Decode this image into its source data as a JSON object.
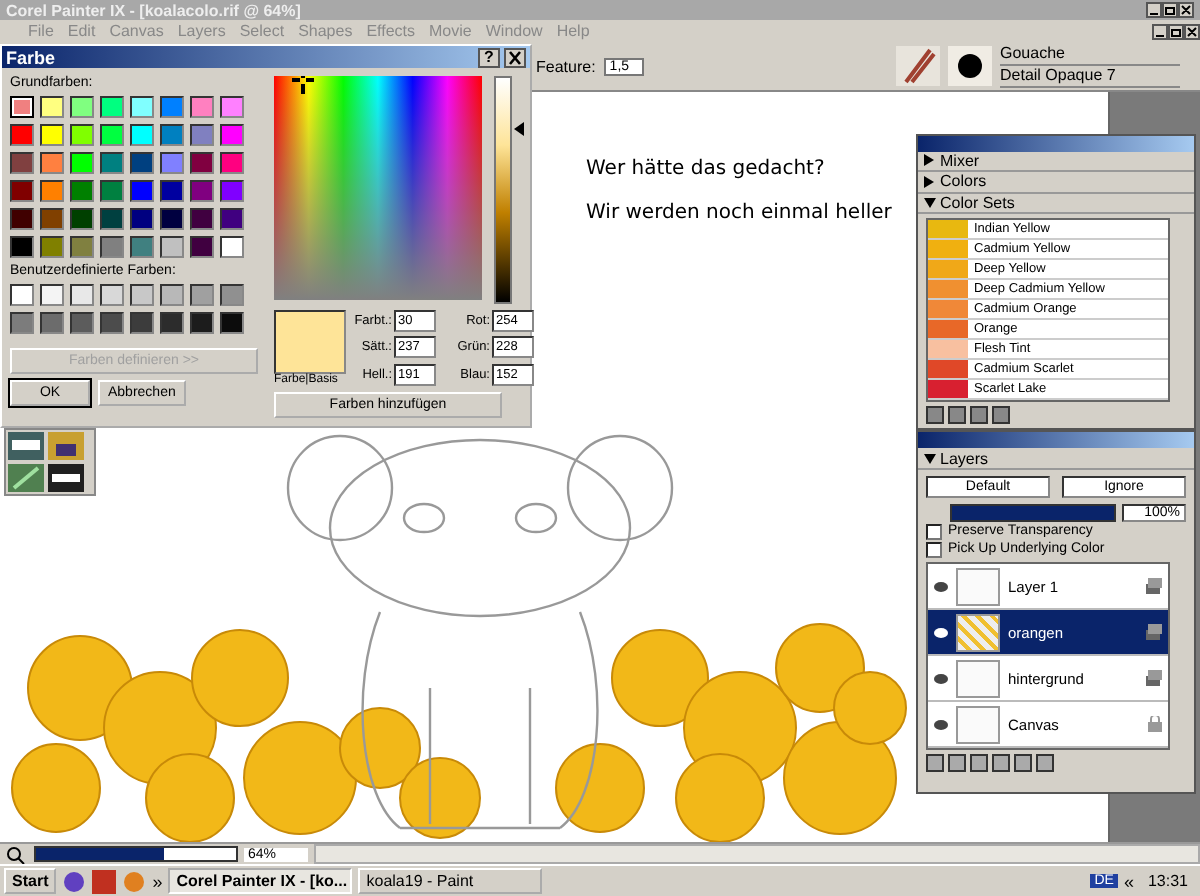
{
  "app": {
    "title": "Corel Painter IX - [koalacolo.rif @ 64%]",
    "menu": [
      "File",
      "Edit",
      "Canvas",
      "Layers",
      "Select",
      "Shapes",
      "Effects",
      "Movie",
      "Window",
      "Help"
    ]
  },
  "property_bar": {
    "feature_label": "Feature:",
    "feature_value": "1,5",
    "brush_category": "Gouache",
    "brush_variant": "Detail Opaque 7"
  },
  "canvas": {
    "caption_lines": [
      "Wer hätte das gedacht?",
      "Wir werden noch einmal heller"
    ]
  },
  "color_dialog": {
    "title": "Farbe",
    "help": "?",
    "basic_label": "Grundfarben:",
    "basic_colors": [
      {
        "color": "#f08080",
        "selected": true
      },
      {
        "color": "#ffff80",
        "selected": false
      },
      {
        "color": "#80ff80",
        "selected": false
      },
      {
        "color": "#00ff80",
        "selected": false
      },
      {
        "color": "#80ffff",
        "selected": false
      },
      {
        "color": "#0080ff",
        "selected": false
      },
      {
        "color": "#ff80c0",
        "selected": false
      },
      {
        "color": "#ff80ff",
        "selected": false
      },
      {
        "color": "#ff0000",
        "selected": false
      },
      {
        "color": "#ffff00",
        "selected": false
      },
      {
        "color": "#80ff00",
        "selected": false
      },
      {
        "color": "#00ff40",
        "selected": false
      },
      {
        "color": "#00ffff",
        "selected": false
      },
      {
        "color": "#0080c0",
        "selected": false
      },
      {
        "color": "#8080c0",
        "selected": false
      },
      {
        "color": "#ff00ff",
        "selected": false
      },
      {
        "color": "#804040",
        "selected": false
      },
      {
        "color": "#ff8040",
        "selected": false
      },
      {
        "color": "#00ff00",
        "selected": false
      },
      {
        "color": "#008080",
        "selected": false
      },
      {
        "color": "#004080",
        "selected": false
      },
      {
        "color": "#8080ff",
        "selected": false
      },
      {
        "color": "#800040",
        "selected": false
      },
      {
        "color": "#ff0080",
        "selected": false
      },
      {
        "color": "#800000",
        "selected": false
      },
      {
        "color": "#ff8000",
        "selected": false
      },
      {
        "color": "#008000",
        "selected": false
      },
      {
        "color": "#008040",
        "selected": false
      },
      {
        "color": "#0000ff",
        "selected": false
      },
      {
        "color": "#0000a0",
        "selected": false
      },
      {
        "color": "#800080",
        "selected": false
      },
      {
        "color": "#8000ff",
        "selected": false
      },
      {
        "color": "#400000",
        "selected": false
      },
      {
        "color": "#804000",
        "selected": false
      },
      {
        "color": "#004000",
        "selected": false
      },
      {
        "color": "#004040",
        "selected": false
      },
      {
        "color": "#000080",
        "selected": false
      },
      {
        "color": "#000040",
        "selected": false
      },
      {
        "color": "#400040",
        "selected": false
      },
      {
        "color": "#400080",
        "selected": false
      },
      {
        "color": "#000000",
        "selected": false
      },
      {
        "color": "#808000",
        "selected": false
      },
      {
        "color": "#808040",
        "selected": false
      },
      {
        "color": "#808080",
        "selected": false
      },
      {
        "color": "#408080",
        "selected": false
      },
      {
        "color": "#c0c0c0",
        "selected": false
      },
      {
        "color": "#400040",
        "selected": false
      },
      {
        "color": "#ffffff",
        "selected": false
      }
    ],
    "custom_label": "Benutzerdefinierte Farben:",
    "custom_colors": [
      {
        "color": "#ffffff"
      },
      {
        "color": "#f4f4f4"
      },
      {
        "color": "#e8e8e8"
      },
      {
        "color": "#d8d8d8"
      },
      {
        "color": "#c8c8c8"
      },
      {
        "color": "#b8b8b8"
      },
      {
        "color": "#a0a0a0"
      },
      {
        "color": "#909090"
      },
      {
        "color": "#7c7c7c"
      },
      {
        "color": "#6c6c6c"
      },
      {
        "color": "#5c5c5c"
      },
      {
        "color": "#4c4c4c"
      },
      {
        "color": "#3c3c3c"
      },
      {
        "color": "#2c2c2c"
      },
      {
        "color": "#1c1c1c"
      },
      {
        "color": "#0c0c0c"
      }
    ],
    "define_button": {
      "label": "Farben definieren >>",
      "disabled": true
    },
    "ok_label": "OK",
    "cancel_label": "Abbrechen",
    "preview": {
      "label": "Farbe|Basis",
      "color": "#fee498"
    },
    "fields": [
      {
        "label": "Farbt.:",
        "value": "30"
      },
      {
        "label": "Rot:",
        "value": "254"
      },
      {
        "label": "Sätt.:",
        "value": "237"
      },
      {
        "label": "Grün:",
        "value": "228"
      },
      {
        "label": "Hell.:",
        "value": "191"
      },
      {
        "label": "Blau:",
        "value": "152"
      }
    ],
    "add_button": "Farben hinzufügen",
    "luminance": {
      "level": 0.78
    }
  },
  "color_panel": {
    "sections": [
      {
        "title": "Mixer",
        "expanded": false
      },
      {
        "title": "Colors",
        "expanded": false
      },
      {
        "title": "Color Sets",
        "expanded": true
      }
    ],
    "colors": [
      {
        "name": "Indian Yellow",
        "color": "#e8b810"
      },
      {
        "name": "Cadmium Yellow",
        "color": "#f0b010"
      },
      {
        "name": "Deep Yellow",
        "color": "#f0a818"
      },
      {
        "name": "Deep Cadmium Yellow",
        "color": "#f09030"
      },
      {
        "name": "Cadmium Orange",
        "color": "#f08838"
      },
      {
        "name": "Orange",
        "color": "#e86828"
      },
      {
        "name": "Flesh Tint",
        "color": "#f8c0a0"
      },
      {
        "name": "Cadmium Scarlet",
        "color": "#e04828"
      },
      {
        "name": "Scarlet Lake",
        "color": "#d82030"
      }
    ]
  },
  "layers_panel": {
    "title": "Layers",
    "expanded": true,
    "method": "Default",
    "composite": "Ignore",
    "opacity": "100%",
    "level": 1,
    "options": [
      {
        "label": "Preserve Transparency",
        "checked": false
      },
      {
        "label": "Pick Up Underlying Color",
        "checked": false
      }
    ],
    "layers": [
      {
        "name": "Layer 1",
        "selected": false,
        "kind": "layer"
      },
      {
        "name": "orangen",
        "selected": true,
        "kind": "layer"
      },
      {
        "name": "hintergrund",
        "selected": false,
        "kind": "layer"
      },
      {
        "name": "Canvas",
        "selected": false,
        "kind": "canvas"
      }
    ]
  },
  "status_bar": {
    "zoom": "64%",
    "level": 0.64
  },
  "taskbar": {
    "start": "Start",
    "chevron": "»",
    "tasks": [
      {
        "label": "Corel Painter IX - [ko...",
        "selected": true
      },
      {
        "label": "koala19 - Paint",
        "selected": false
      }
    ],
    "language": "DE",
    "tray_chevron": "«",
    "clock": "13:31"
  }
}
